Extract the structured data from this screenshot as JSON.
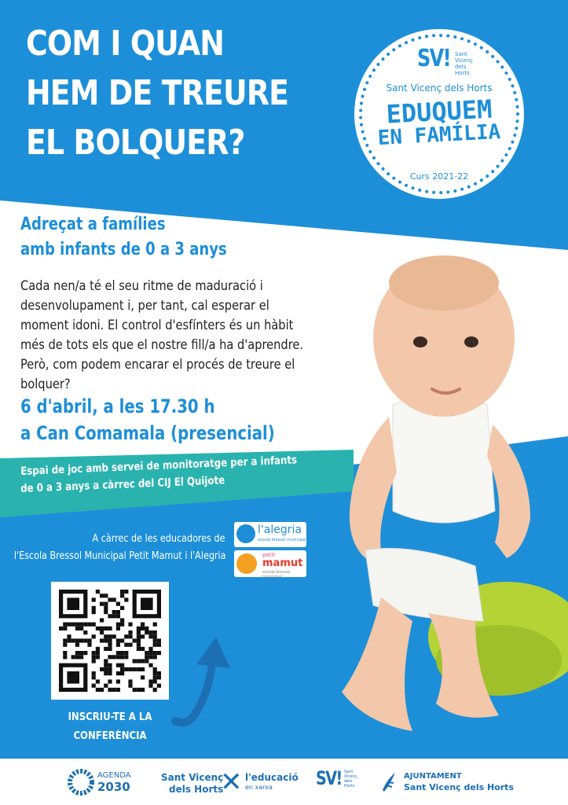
{
  "title": {
    "lines": [
      "COM I QUAN",
      "HEM DE TREURE",
      "EL BOLQUER?"
    ]
  },
  "badge": {
    "logo": "SV!",
    "logo_side": [
      "Sant",
      "Vicenç",
      "dels",
      "Horts"
    ],
    "town": "Sant Vicenç dels Horts",
    "program_line1": "EDUQUEM",
    "program_line2": "EN FAMÍLIA",
    "course": "Curs 2021-22"
  },
  "audience": [
    "Adreçat a famílies",
    "amb infants de 0 a 3 anys"
  ],
  "description": "Cada nen/a té el seu ritme de maduració i desenvolupament i, per tant, cal esperar el moment idoni. El control d'esfínters és un hàbit més de tots els que el nostre fill/a ha d'aprendre. Però, com podem encarar el procés de treure el bolquer?",
  "event": {
    "date_time": "6 d'abril, a les 17.30 h",
    "place": "a Can Comamala (presencial)"
  },
  "childcare_banner": [
    "Espai de joc amb servei de monitoratge per a infants",
    "de 0 a 3 anys a càrrec del CIJ El Quijote"
  ],
  "educators": [
    "A càrrec de les educadores de",
    "l'Escola Bressol Municipal Petit Mamut i l'Alegria"
  ],
  "partners": {
    "alegria_name": "l'alegria",
    "alegria_sub": "escola bressol municipal",
    "mamut_top": "petit",
    "mamut_name": "mamut",
    "mamut_sub": "escola bressol municipal"
  },
  "signup": [
    "INSCRIU-TE A LA",
    "CONFERÈNCIA"
  ],
  "footer": {
    "agenda_line1": "AGENDA",
    "agenda_line2": "2030",
    "educacio_left1": "Sant Vicenç",
    "educacio_left2": "dels Horts",
    "educacio_right1": "l'educació",
    "educacio_right2": "en xarxa",
    "svh_logo": "SV!",
    "svh_side": [
      "Sant",
      "Vicenç",
      "dels",
      "Horts"
    ],
    "ajuntament_line1": "AJUNTAMENT",
    "ajuntament_line2": "Sant Vicenç dels Horts"
  },
  "colors": {
    "blue": "#1d8fd8",
    "teal": "#2ab3ae",
    "white": "#ffffff",
    "potty_green": "#b5d334",
    "footer_blue": "#1d6fb3"
  }
}
